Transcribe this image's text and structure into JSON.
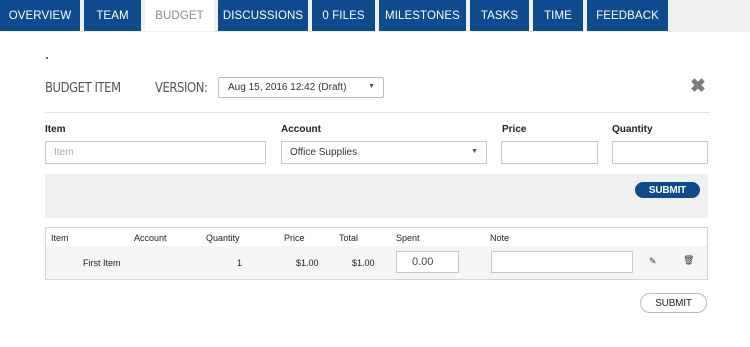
{
  "tabs": [
    {
      "label": "OVERVIEW"
    },
    {
      "label": "TEAM"
    },
    {
      "label": "BUDGET"
    },
    {
      "label": "DISCUSSIONS"
    },
    {
      "label": "0 FILES"
    },
    {
      "label": "MILESTONES"
    },
    {
      "label": "TASKS"
    },
    {
      "label": "TIME"
    },
    {
      "label": "FEEDBACK"
    }
  ],
  "active_tab": "BUDGET",
  "dot": ".",
  "header": {
    "title": "BUDGET ITEM",
    "version_label": "VERSION:",
    "version_selected": "Aug 15, 2016 12:42 (Draft)"
  },
  "form": {
    "item_label": "Item",
    "item_placeholder": "Item",
    "account_label": "Account",
    "account_selected": "Office Supplies",
    "price_label": "Price",
    "price_value": "",
    "quantity_label": "Quantity",
    "quantity_value": ""
  },
  "panel": {
    "submit_label": "SUBMIT"
  },
  "table": {
    "headers": [
      "Item",
      "Account",
      "Quantity",
      "Price",
      "Total",
      "Spent",
      "Note"
    ],
    "rows": [
      {
        "item": "First Item",
        "account": "",
        "quantity": "1",
        "price": "$1.00",
        "total": "$1.00",
        "spent": "0.00",
        "note": ""
      }
    ]
  },
  "footer": {
    "submit_label": "SUBMIT"
  },
  "colors": {
    "tab_bg": "#0d4a8e",
    "active_tab_bg": "#ffffff",
    "panel_bg": "#f0f0f0"
  }
}
